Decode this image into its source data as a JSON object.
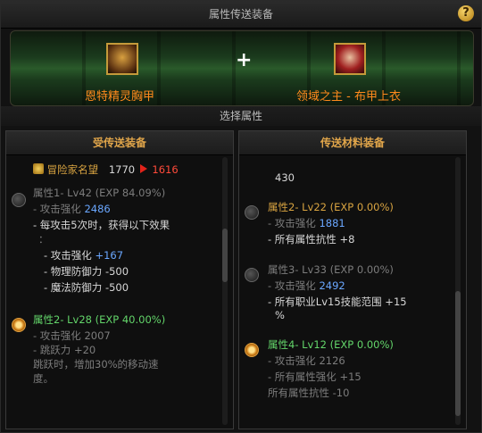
{
  "window": {
    "title": "属性传送装备",
    "help_glyph": "?"
  },
  "banner": {
    "plus": "+",
    "left_item": {
      "name": "恩特精灵胸甲",
      "icon": "chest-armor-icon"
    },
    "right_item": {
      "name": "领域之主 - 布甲上衣",
      "icon": "cloth-top-icon"
    }
  },
  "subtitle": "选择属性",
  "left_panel": {
    "title": "受传送装备",
    "fame": {
      "label": "冒险家名望",
      "from": "1770",
      "to": "1616",
      "icon": "fame-icon"
    },
    "attr1": {
      "header": "属性1- Lv42 (EXP 84.09%)",
      "lines": [
        {
          "text": "- 攻击强化 ",
          "value": "2486"
        },
        {
          "text": "- 每攻击5次时，获得以下效果"
        },
        {
          "text": "："
        },
        {
          "text": "- 攻击强化 ",
          "value": "+167"
        },
        {
          "text": "- 物理防御力 -500"
        },
        {
          "text": "- 魔法防御力 -500"
        }
      ]
    },
    "attr2": {
      "header": "属性2- Lv28 (EXP 40.00%)",
      "lines": [
        {
          "text": "- 攻击强化 2007"
        },
        {
          "text": "- 跳跃力 +20"
        },
        {
          "text": "  跳跃时，增加30%的移动速"
        },
        {
          "text": "  度。"
        }
      ]
    }
  },
  "right_panel": {
    "title": "传送材料装备",
    "top_value": "430",
    "attr2": {
      "header": "属性2- Lv22 (EXP 0.00%)",
      "lines": [
        {
          "text": "- 攻击强化 ",
          "value": "1881"
        },
        {
          "text": "- 所有属性抗性 +8"
        }
      ]
    },
    "attr3": {
      "header": "属性3- Lv33 (EXP 0.00%)",
      "lines": [
        {
          "text": "- 攻击强化 ",
          "value": "2492"
        },
        {
          "text": "- 所有职业Lv15技能范围 +15"
        },
        {
          "text": "%"
        }
      ]
    },
    "attr4": {
      "header": "属性4- Lv12 (EXP 0.00%)",
      "lines": [
        {
          "text": "- 攻击强化 2126"
        },
        {
          "text": "- 所有属性强化 +15"
        },
        {
          "text": "  所有属性抗性 -10"
        }
      ]
    }
  }
}
